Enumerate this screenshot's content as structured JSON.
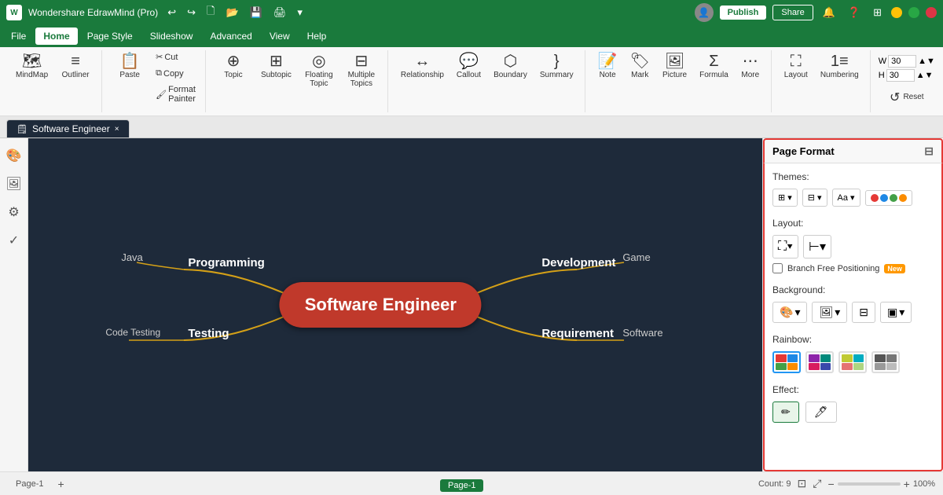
{
  "app": {
    "title": "Wondershare EdrawMind (Pro)",
    "logo_text": "W"
  },
  "titlebar": {
    "undo": "↩",
    "redo": "↪",
    "new": "🗋",
    "open": "📁",
    "save": "💾",
    "print": "🖨",
    "more": "▾",
    "publish_label": "Publish",
    "share_label": "Share",
    "bell_icon": "🔔",
    "help_icon": "❓",
    "grid_icon": "⊞",
    "user_avatar": "👤"
  },
  "menu": {
    "items": [
      "File",
      "Home",
      "Page Style",
      "Slideshow",
      "Advanced",
      "View",
      "Help"
    ]
  },
  "ribbon": {
    "mindmap_label": "MindMap",
    "outliner_label": "Outliner",
    "paste_label": "Paste",
    "cut_label": "Cut",
    "copy_label": "Copy",
    "format_painter_label": "Format\nPainter",
    "topic_label": "Topic",
    "subtopic_label": "Subtopic",
    "floating_topic_label": "Floating\nTopic",
    "multiple_topics_label": "Multiple\nTopics",
    "relationship_label": "Relationship",
    "callout_label": "Callout",
    "boundary_label": "Boundary",
    "summary_label": "Summary",
    "note_label": "Note",
    "mark_label": "Mark",
    "picture_label": "Picture",
    "formula_label": "Formula",
    "more_label": "More",
    "layout_label": "Layout",
    "numbering_label": "Numbering",
    "reset_label": "Reset",
    "size_w": "30",
    "size_h": "30"
  },
  "tab": {
    "name": "Software Engineer",
    "close_icon": "×"
  },
  "mindmap": {
    "center": "Software Engineer",
    "left_branches": [
      {
        "main": "Programming",
        "leaf": "Java"
      },
      {
        "main": "Testing",
        "leaf": "Code Testing"
      }
    ],
    "right_branches": [
      {
        "main": "Development",
        "leaf": "Game"
      },
      {
        "main": "Requirement",
        "leaf": "Software"
      }
    ]
  },
  "sidebar_icons": [
    "🎨",
    "🖼",
    "⚙",
    "✓"
  ],
  "page_format": {
    "title": "Page Format",
    "themes_label": "Themes:",
    "layout_label": "Layout:",
    "background_label": "Background:",
    "rainbow_label": "Rainbow:",
    "effect_label": "Effect:",
    "branch_free_label": "Branch Free Positioning",
    "new_badge": "New",
    "close_icon": "⊟"
  },
  "status": {
    "page_label": "Page-1",
    "add_page": "+",
    "page_name": "Page-1",
    "count_label": "Count: 9",
    "zoom_percent": "100%",
    "fit_icon": "⊡",
    "expand_icon": "⤢"
  }
}
